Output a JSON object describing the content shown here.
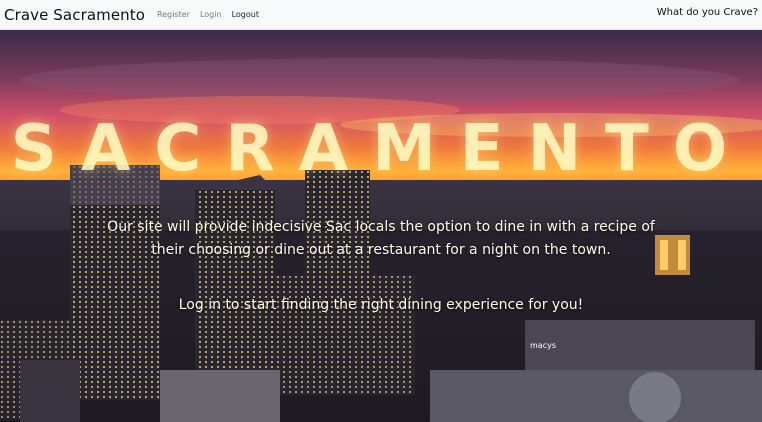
{
  "navbar": {
    "brand": "Crave Sacramento",
    "links": [
      {
        "label": "Register"
      },
      {
        "label": "Login"
      },
      {
        "label": "Logout"
      }
    ],
    "right_label": "What do you Crave?"
  },
  "hero": {
    "title": "SACRAMENTO",
    "description": "Our site will provide indecisive Sac locals the option to dine in with a recipe of their choosing or dine out at a restaurant for a night on the town.",
    "call_to_action": "Log in to start finding the right dining experience for you!",
    "sign_text": "macys"
  }
}
